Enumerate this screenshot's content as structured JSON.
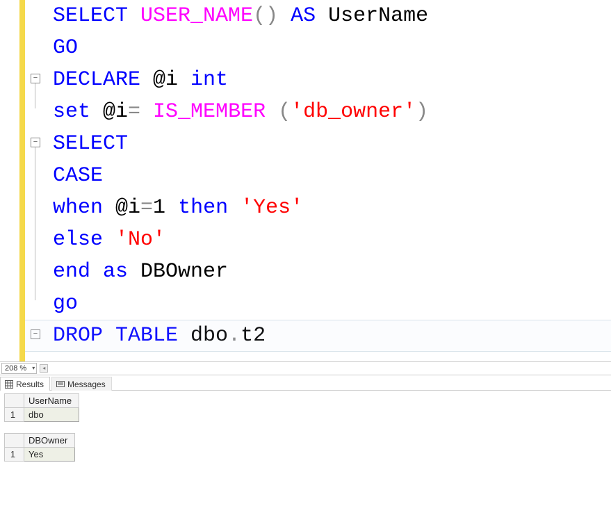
{
  "editor": {
    "zoom": "208 %",
    "lines": [
      {
        "tokens": [
          [
            "kw-blue",
            "SELECT "
          ],
          [
            "kw-magenta",
            "USER_NAME"
          ],
          [
            "op",
            "() "
          ],
          [
            "kw-blue",
            "AS"
          ],
          [
            "plain",
            " UserName"
          ]
        ]
      },
      {
        "tokens": [
          [
            "kw-blue",
            "GO"
          ]
        ]
      },
      {
        "fold": true,
        "tokens": [
          [
            "kw-blue",
            "DECLARE"
          ],
          [
            "plain",
            " @i "
          ],
          [
            "kw-blue",
            "int"
          ]
        ]
      },
      {
        "tokens": [
          [
            "kw-blue",
            "set"
          ],
          [
            "plain",
            " @i"
          ],
          [
            "op",
            "= "
          ],
          [
            "kw-magenta",
            "IS_MEMBER"
          ],
          [
            "plain",
            " "
          ],
          [
            "op",
            "("
          ],
          [
            "kw-red",
            "'db_owner'"
          ],
          [
            "op",
            ")"
          ]
        ]
      },
      {
        "fold": true,
        "tokens": [
          [
            "kw-blue",
            "SELECT"
          ]
        ]
      },
      {
        "tokens": [
          [
            "kw-blue",
            "CASE"
          ]
        ]
      },
      {
        "tokens": [
          [
            "kw-blue",
            "when"
          ],
          [
            "plain",
            " @i"
          ],
          [
            "op",
            "="
          ],
          [
            "plain",
            "1 "
          ],
          [
            "kw-blue",
            "then "
          ],
          [
            "kw-red",
            "'Yes'"
          ]
        ]
      },
      {
        "tokens": [
          [
            "kw-blue",
            "else "
          ],
          [
            "kw-red",
            "'No'"
          ]
        ]
      },
      {
        "tokens": [
          [
            "kw-blue",
            "end as"
          ],
          [
            "plain",
            " DBOwner"
          ]
        ]
      },
      {
        "tokens": [
          [
            "kw-blue",
            "go"
          ]
        ]
      },
      {
        "fold": true,
        "current": true,
        "tokens": [
          [
            "kw-blue",
            "DROP TABLE"
          ],
          [
            "plain",
            " dbo"
          ],
          [
            "op",
            "."
          ],
          [
            "plain",
            "t2"
          ]
        ]
      }
    ]
  },
  "tabs": {
    "results": "Results",
    "messages": "Messages"
  },
  "results": [
    {
      "columns": [
        "UserName"
      ],
      "rows": [
        [
          "dbo"
        ]
      ]
    },
    {
      "columns": [
        "DBOwner"
      ],
      "rows": [
        [
          "Yes"
        ]
      ]
    }
  ]
}
